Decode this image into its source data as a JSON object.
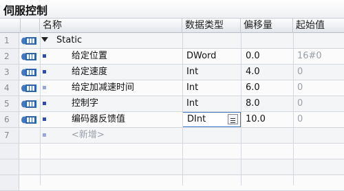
{
  "title": "伺服控制",
  "columns": {
    "name": "名称",
    "datatype": "数据类型",
    "offset": "偏移量",
    "start": "起始值"
  },
  "rows": [
    {
      "num": "1",
      "name": "Static",
      "type": "",
      "offset": "",
      "start": ""
    },
    {
      "num": "2",
      "name": "给定位置",
      "type": "DWord",
      "offset": "0.0",
      "start": "16#0"
    },
    {
      "num": "3",
      "name": "给定速度",
      "type": "Int",
      "offset": "4.0",
      "start": "0"
    },
    {
      "num": "4",
      "name": "给定加减速时间",
      "type": "Int",
      "offset": "6.0",
      "start": "0"
    },
    {
      "num": "5",
      "name": "控制字",
      "type": "Int",
      "offset": "8.0",
      "start": "0"
    },
    {
      "num": "6",
      "name": "编码器反馈值",
      "type": "DInt",
      "offset": "10.0",
      "start": "0"
    },
    {
      "num": "7",
      "name": "<新增>",
      "type": "",
      "offset": "",
      "start": ""
    }
  ]
}
